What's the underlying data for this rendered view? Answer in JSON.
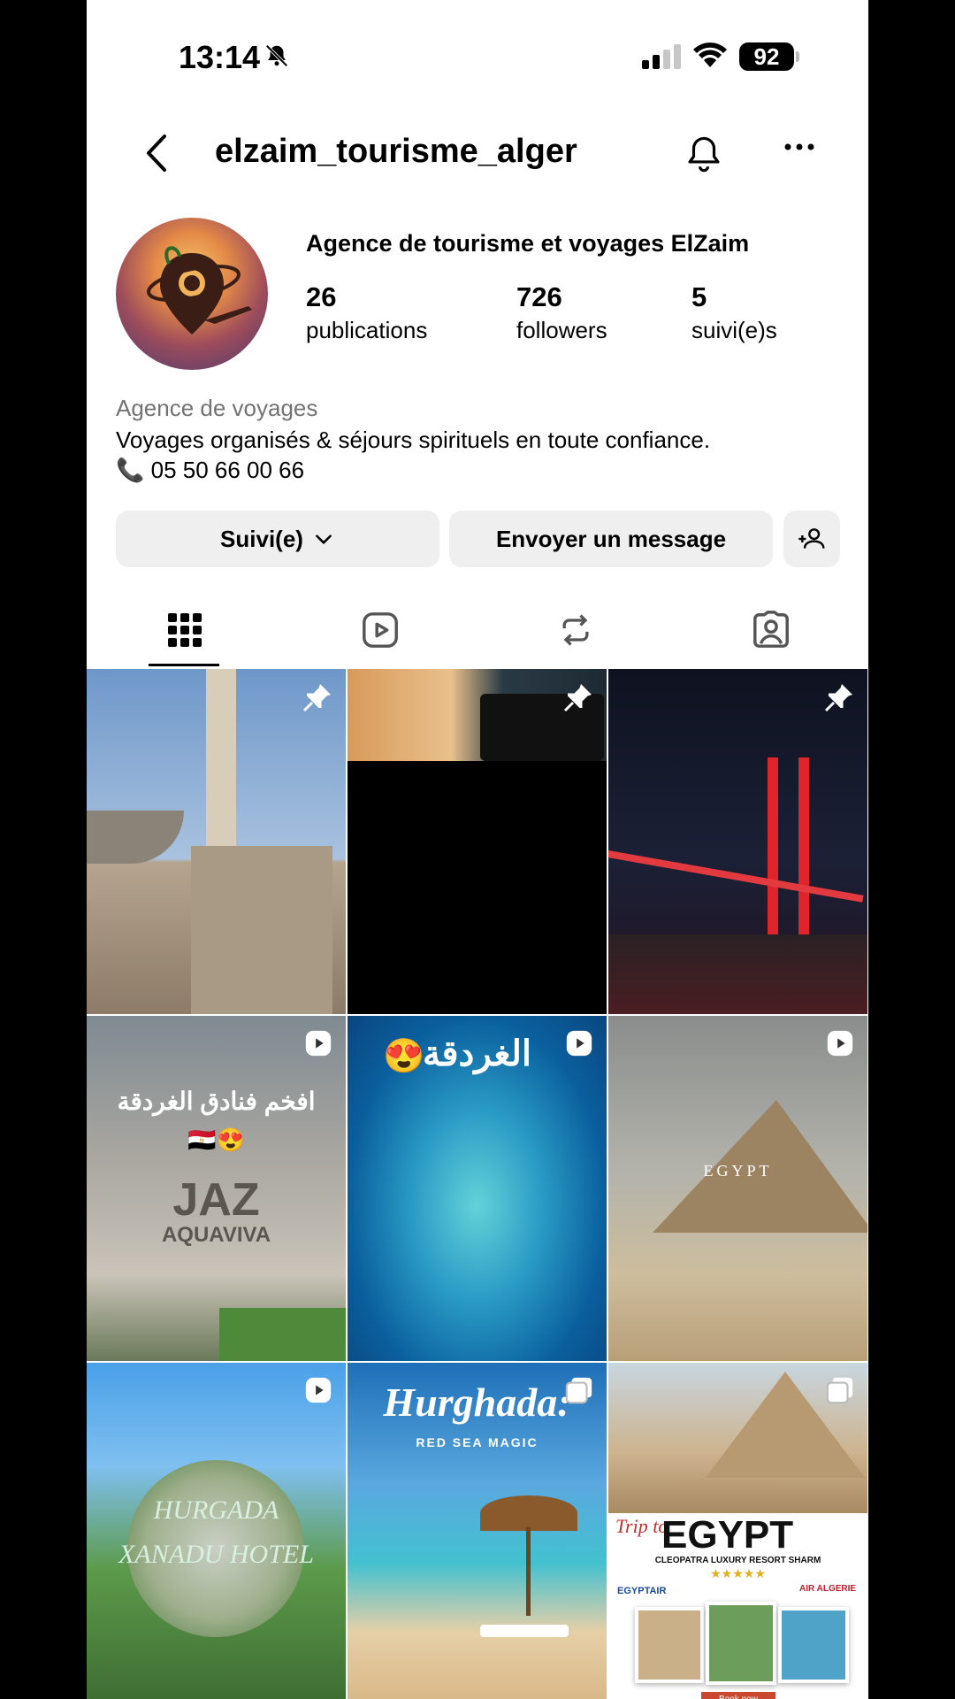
{
  "status_bar": {
    "time": "13:14",
    "battery": "92"
  },
  "header": {
    "username": "elzaim_tourisme_alger"
  },
  "profile": {
    "full_name": "Agence de tourisme et voyages ElZaim",
    "stats": [
      {
        "value": "26",
        "label": "publications"
      },
      {
        "value": "726",
        "label": "followers"
      },
      {
        "value": "5",
        "label": "suivi(e)s"
      }
    ],
    "category": "Agence de voyages",
    "bio": "Voyages organisés & séjours spirituels en toute confiance.",
    "phone": "05 50 66 00 66"
  },
  "actions": {
    "follow": "Suivi(e)",
    "message": "Envoyer un message"
  },
  "grid": {
    "posts": [
      {
        "type": "pinned"
      },
      {
        "type": "pinned"
      },
      {
        "type": "pinned"
      },
      {
        "type": "reel",
        "caption": "افخم فنادق الغردقة",
        "sub": "JAZ",
        "sub2": "AQUAVIVA"
      },
      {
        "type": "reel",
        "caption": "الغردقة"
      },
      {
        "type": "reel",
        "caption": "EGYPT"
      },
      {
        "type": "reel",
        "caption": "HURGADA",
        "sub": "XANADU HOTEL"
      },
      {
        "type": "carousel",
        "caption": "Hurghada:",
        "sub": "RED SEA MAGIC"
      },
      {
        "type": "carousel",
        "caption": "EGYPT",
        "pre": "Trip to",
        "sub": "CLEOPATRA LUXURY RESORT SHARM",
        "brand1": "EGYPTAIR",
        "brand2": "AIR ALGERIE",
        "cta": "Book now"
      }
    ]
  }
}
